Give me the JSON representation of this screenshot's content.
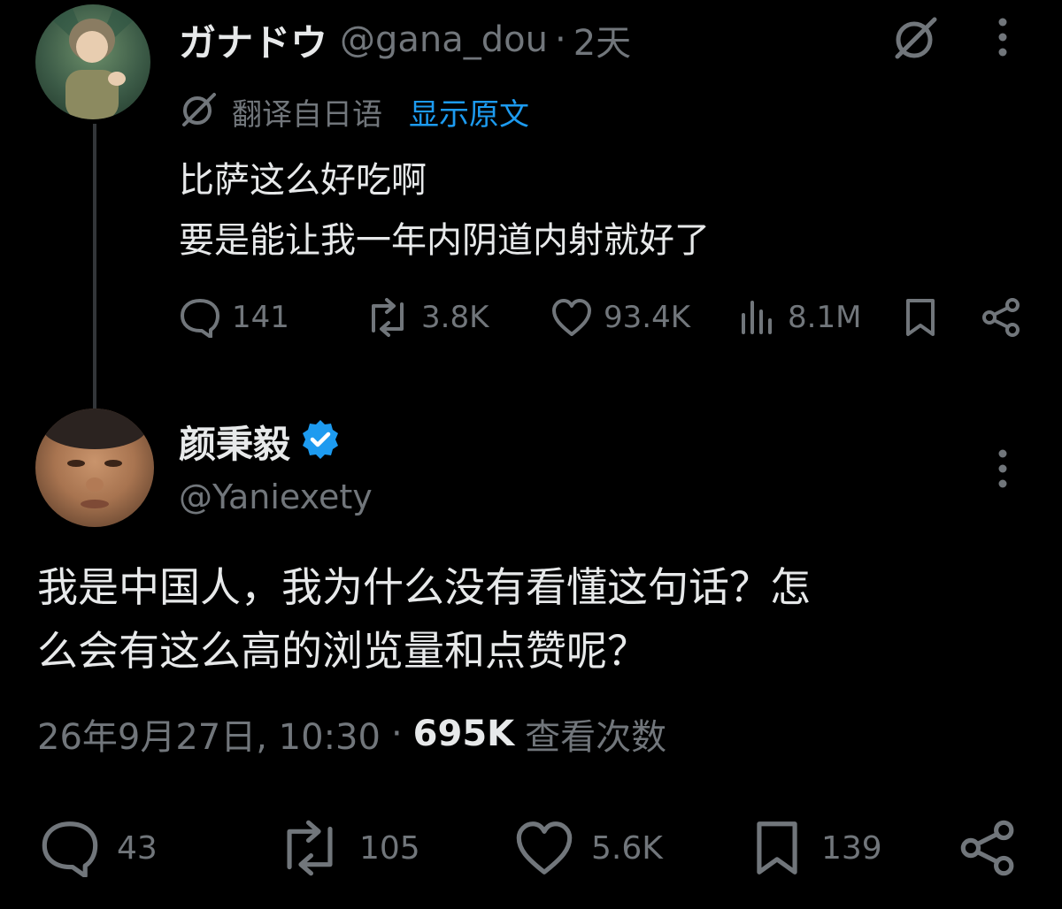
{
  "colors": {
    "background": "#000000",
    "text": "#e7e9ea",
    "muted": "#71767b",
    "link": "#1d9bf0",
    "verified": "#1d9bf0"
  },
  "parent": {
    "display_name": "ガナドウ",
    "handle": "@gana_dou",
    "separator": "·",
    "age": "2天",
    "translate_label": "翻译自日语",
    "show_original": "显示原文",
    "text_line1": "比萨这么好吃啊",
    "text_line2": "要是能让我一年内阴道内射就好了",
    "metrics": {
      "replies": "141",
      "reposts": "3.8K",
      "likes": "93.4K",
      "views": "8.1M"
    }
  },
  "reply": {
    "display_name": "颜秉毅",
    "handle": "@Yaniexety",
    "text_line1": "我是中国人，我为什么没有看懂这句话？怎",
    "text_line2": "么会有这么高的浏览量和点赞呢？",
    "timestamp": "26年9月27日, 10:30",
    "dot": "·",
    "views_count": "695K",
    "views_label": "查看次数",
    "metrics": {
      "replies": "43",
      "reposts": "105",
      "likes": "5.6K",
      "bookmarks": "139"
    }
  },
  "icons": [
    "grok-icon",
    "more-icon",
    "translate-icon",
    "reply-icon",
    "repost-icon",
    "like-icon",
    "views-icon",
    "bookmark-icon",
    "share-icon",
    "verified-badge-icon"
  ]
}
